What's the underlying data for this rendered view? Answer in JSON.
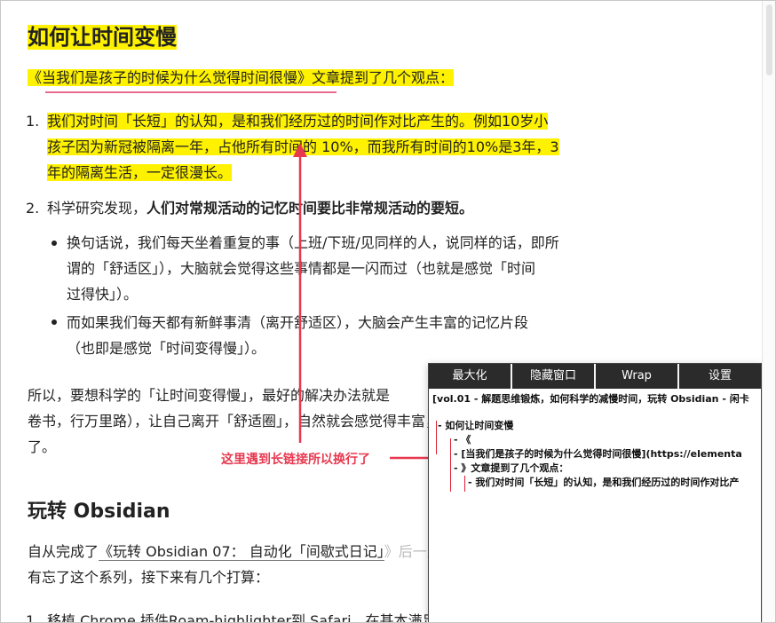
{
  "article": {
    "h1": "如何让时间变慢",
    "intro": "《当我们是孩子的时候为什么觉得时间很慢》文章提到了几个观点：",
    "item1_num": "1.",
    "item1_line1": "我们对时间「长短」的认知，是和我们经历过的时间作对比产生的。例如10岁小",
    "item1_line2": "孩子因为新冠被隔离一年，占他所有时间的 10%，而我所有时间的10%是3年，3",
    "item1_line3": "年的隔离生活，一定很漫长。",
    "item2_num": "2.",
    "item2_prefix": "科学研究发现，",
    "item2_bold": "人们对常规活动的记忆时间要比非常规活动的要短。",
    "bullet1_line1": "换句话说，我们每天坐着重复的事（上班/下班/见同样的人，说同样的话，即所",
    "bullet1_line2": "谓的「舒适区」），大脑就会觉得这些事情都是一闪而过（也就是感觉「时间",
    "bullet1_line3": "过得快」）。",
    "bullet2_line1": "而如果我们每天都有新鲜事清（离开舒适区），大脑会产生丰富的记忆片段",
    "bullet2_line2": "（也即是感觉「时间变得慢」）。",
    "concl_line1": "所以，要想科学的「让时间变得慢」，最好的解决办法就是",
    "concl_line1_tail": "，",
    "concl_line2": "卷书，行万里路），让自己离开「舒适圈」，自然就会感觉得丰富，感觉时间变慢",
    "concl_line3": "了。",
    "h2": "玩转 Obsidian",
    "p3_line1_a": "自从完成了",
    "p3_link": "《玩转 Obsidian 07： 自动化「间歇式日记」",
    "p3_line1_b": "》后一直没更新，其实并没",
    "p3_line2": "有忘了这个系列，接下来有几个打算：",
    "item3_num": "1.",
    "item3_text": "移植 Chrome 插件Roam-highlighter到 Safari，在基本满足的基础上，结合 URL-"
  },
  "annotation": "这里遇到长链接所以换行了",
  "panel": {
    "toolbar": [
      "最大化",
      "隐藏窗口",
      "Wrap",
      "设置"
    ],
    "title_line": "[vol.01 - 解题思维锻炼，如何科学的减慢时间，玩转 Obsidian - 闲卡",
    "lines": [
      "- 如何让时间变慢",
      "- 《",
      "- [当我们是孩子的时候为什么觉得时间很慢](https://elementa",
      "- 》文章提到了几个观点：",
      "- 我们对时间「长短」的认知，是和我们经历过的时间作对比产"
    ]
  },
  "colors": {
    "highlight": "#fff200",
    "accent_red": "#e8384f",
    "toolbar_bg": "#2b2b2b"
  }
}
